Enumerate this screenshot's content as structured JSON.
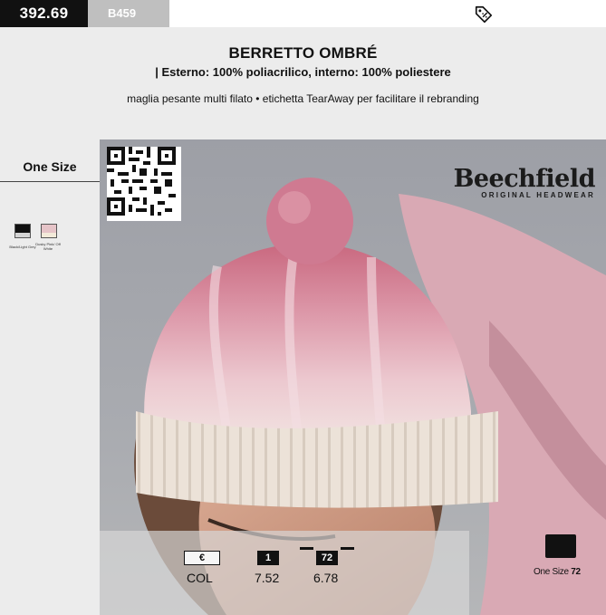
{
  "top_bar": {
    "page_code": "392.69",
    "sku": "B459",
    "icon": "price-tag-icon"
  },
  "header": {
    "title": "BERRETTO OMBRÉ",
    "subtitle": "| Esterno: 100% poliacrilico, interno: 100% poliestere",
    "description": "maglia pesante multi filato • etichetta TearAway per facilitare il rebranding"
  },
  "sizes": {
    "label": "One Size"
  },
  "colors": [
    {
      "name": "Black/Light Grey",
      "hex_top": "#111111",
      "hex_bottom": "#d4d4d4"
    },
    {
      "name": "Dusky Pink/ Off White",
      "hex_top": "#e6c4c8",
      "hex_bottom": "#f3ead9"
    }
  ],
  "brand": {
    "name": "Beechfield",
    "tagline": "ORIGINAL HEADWEAR"
  },
  "pricing": {
    "currency": "€",
    "col_label": "COL",
    "tiers": [
      {
        "qty": "1",
        "price": "7.52"
      },
      {
        "qty": "72",
        "price": "6.78"
      }
    ]
  },
  "packaging": {
    "size_label": "One Size",
    "qty": "72"
  }
}
